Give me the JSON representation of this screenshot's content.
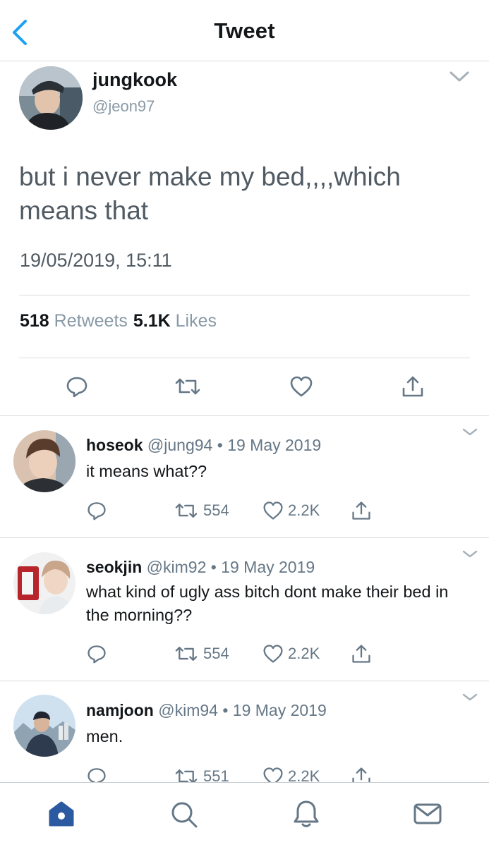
{
  "header": {
    "title": "Tweet",
    "back_icon": "chevron-left-icon"
  },
  "colors": {
    "accent": "#1da1f2",
    "home_active": "#2c5aa0",
    "text": "#14171a",
    "muted": "#657786"
  },
  "main_tweet": {
    "name": "jungkook",
    "handle": "@jeon97",
    "text": "but i never make my bed,,,,which means that",
    "timestamp": "19/05/2019, 15:11",
    "retweets": "518",
    "retweets_label": "Retweets",
    "likes": "5.1K",
    "likes_label": "Likes"
  },
  "replies": [
    {
      "name": "hoseok",
      "handle": "@jung94",
      "date": "19 May 2019",
      "text": "it means what??",
      "retweets": "554",
      "likes": "2.2K"
    },
    {
      "name": "seokjin",
      "handle": "@kim92",
      "date": "19 May 2019",
      "text": "what kind of ugly ass bitch dont make their bed in the morning??",
      "retweets": "554",
      "likes": "2.2K"
    },
    {
      "name": "namjoon",
      "handle": "@kim94",
      "date": "19 May 2019",
      "text": "men.",
      "retweets": "551",
      "likes": "2.2K"
    }
  ],
  "meta_separator": " • ",
  "tabbar": {
    "items": [
      "home-icon",
      "search-icon",
      "notifications-icon",
      "messages-icon"
    ],
    "active": "home-icon"
  }
}
